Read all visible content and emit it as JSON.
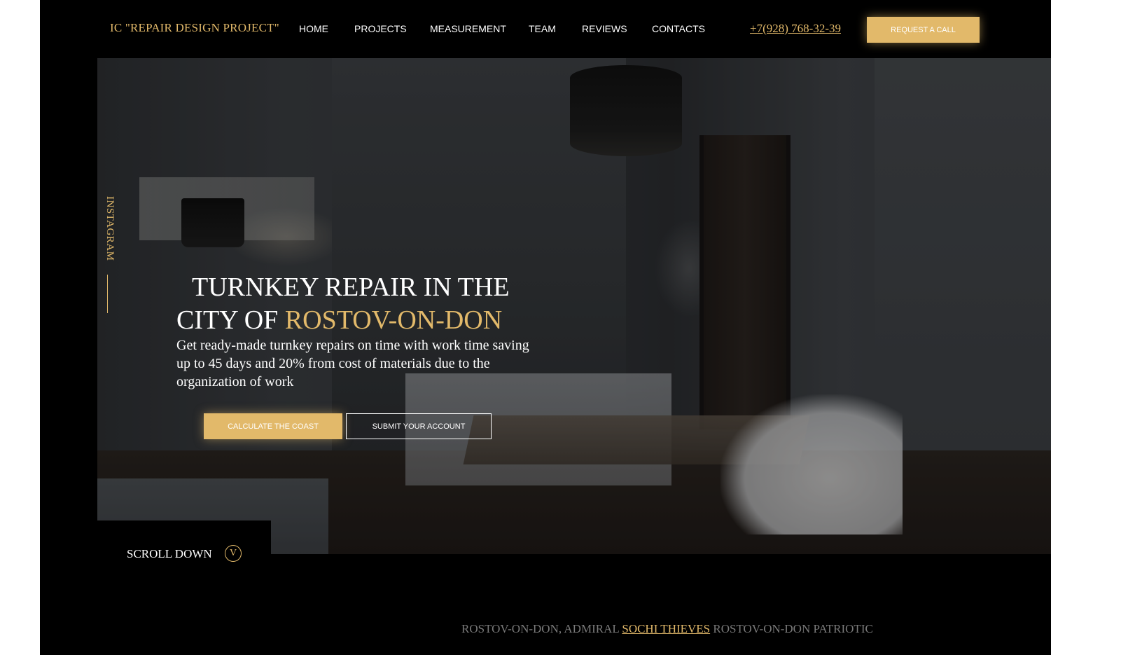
{
  "header": {
    "logo": "IC \"REPAIR DESIGN PROJECT\"",
    "nav": [
      {
        "label": "HOME"
      },
      {
        "label": "PROJECTS"
      },
      {
        "label": "MEASUREMENT"
      },
      {
        "label": "TEAM"
      },
      {
        "label": "REVIEWS"
      },
      {
        "label": "CONTACTS"
      }
    ],
    "phone": "+7(928) 768-32-39",
    "request_button": "REQUEST A CALL"
  },
  "sidebar": {
    "instagram": "INSTAGRAM"
  },
  "hero": {
    "title_line1": "TURNKEY REPAIR IN THE",
    "title_line2_prefix": "CITY OF ",
    "title_line2_accent": "ROSTOV-ON-DON",
    "description": "Get ready-made turnkey repairs on time with work time saving up to 45 days and 20% from cost of materials due to the organization of work",
    "calc_button": "CALCULATE THE COAST",
    "submit_button": "SUBMIT YOUR ACCOUNT"
  },
  "scroll": {
    "label": "SCROLL DOWN",
    "icon_glyph": "V",
    "icon": "chevron-down-icon"
  },
  "locations": {
    "before": "ROSTOV-ON-DON, ADMIRAL ",
    "active": "SOCHI THIEVES",
    "after": " ROSTOV-ON-DON PATRIOTIC"
  },
  "colors": {
    "accent": "#e2b96a",
    "background": "#000000",
    "text": "#ffffff",
    "muted": "#7a7a7a"
  }
}
